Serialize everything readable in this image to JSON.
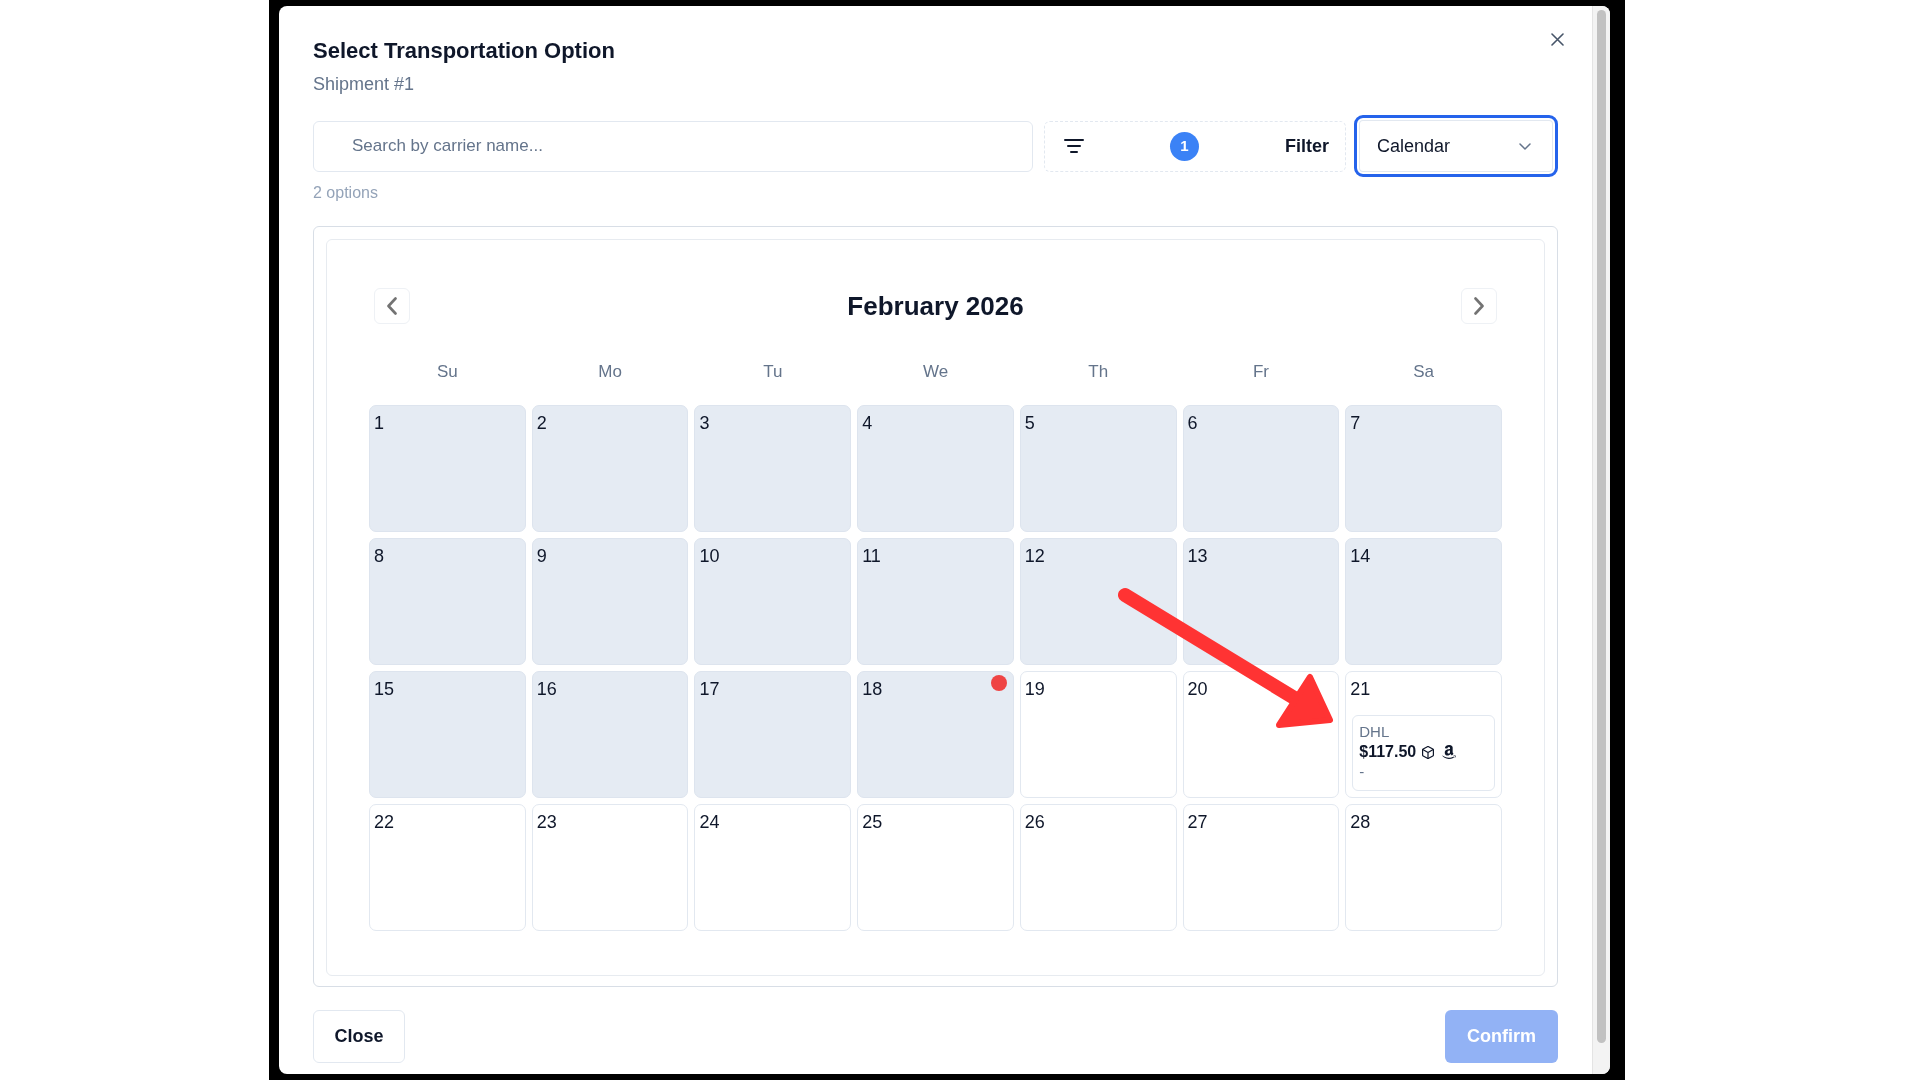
{
  "dialog": {
    "title": "Select Transportation Option",
    "subtitle": "Shipment #1"
  },
  "search": {
    "placeholder": "Search by carrier name..."
  },
  "filter": {
    "label": "Filter",
    "badge": "1"
  },
  "view_select": {
    "value": "Calendar",
    "focused": true
  },
  "result_count": "2 options",
  "calendar": {
    "month": "February 2026",
    "weekdays": [
      "Su",
      "Mo",
      "Tu",
      "We",
      "Th",
      "Fr",
      "Sa"
    ],
    "days": [
      {
        "label": "1",
        "disabled": true,
        "today": false
      },
      {
        "label": "2",
        "disabled": true,
        "today": false
      },
      {
        "label": "3",
        "disabled": true,
        "today": false
      },
      {
        "label": "4",
        "disabled": true,
        "today": false
      },
      {
        "label": "5",
        "disabled": true,
        "today": false
      },
      {
        "label": "6",
        "disabled": true,
        "today": false
      },
      {
        "label": "7",
        "disabled": true,
        "today": false
      },
      {
        "label": "8",
        "disabled": true,
        "today": false
      },
      {
        "label": "9",
        "disabled": true,
        "today": false
      },
      {
        "label": "10",
        "disabled": true,
        "today": false
      },
      {
        "label": "11",
        "disabled": true,
        "today": false
      },
      {
        "label": "12",
        "disabled": true,
        "today": false
      },
      {
        "label": "13",
        "disabled": true,
        "today": false
      },
      {
        "label": "14",
        "disabled": true,
        "today": false
      },
      {
        "label": "15",
        "disabled": true,
        "today": false
      },
      {
        "label": "16",
        "disabled": true,
        "today": false
      },
      {
        "label": "17",
        "disabled": true,
        "today": false
      },
      {
        "label": "18",
        "disabled": true,
        "today": true
      },
      {
        "label": "19",
        "disabled": false,
        "today": false
      },
      {
        "label": "20",
        "disabled": false,
        "today": false
      },
      {
        "label": "21",
        "disabled": false,
        "today": false,
        "events": [
          {
            "carrier": "DHL",
            "price": "$117.50",
            "note": "-"
          }
        ]
      },
      {
        "label": "22",
        "disabled": false,
        "today": false
      },
      {
        "label": "23",
        "disabled": false,
        "today": false
      },
      {
        "label": "24",
        "disabled": false,
        "today": false
      },
      {
        "label": "25",
        "disabled": false,
        "today": false
      },
      {
        "label": "26",
        "disabled": false,
        "today": false
      },
      {
        "label": "27",
        "disabled": false,
        "today": false
      },
      {
        "label": "28",
        "disabled": false,
        "today": false
      }
    ]
  },
  "annotations": [
    {
      "kind": "arrow"
    }
  ],
  "footer": {
    "close": {
      "label": "Close"
    },
    "confirm": {
      "label": "Confirm",
      "disabled": true
    }
  }
}
